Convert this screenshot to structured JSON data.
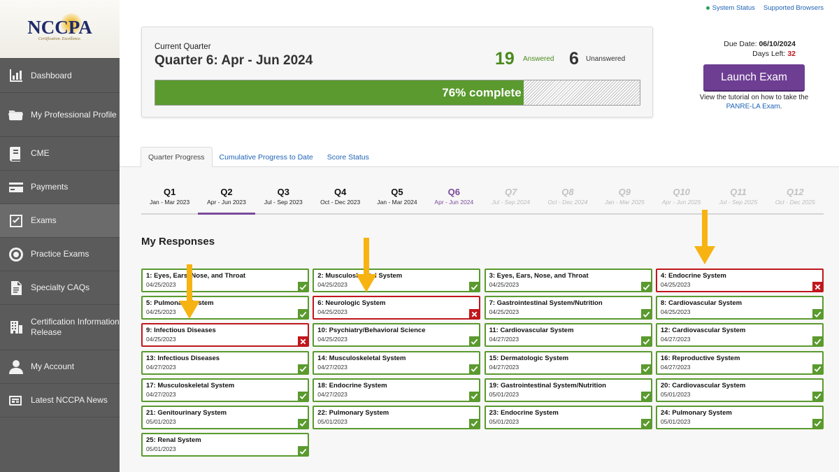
{
  "logo": {
    "text": "NCCPA",
    "tagline": "Certification. Excellence."
  },
  "sidebar": {
    "items": [
      {
        "label": "Dashboard",
        "icon": "chart-icon",
        "active": false
      },
      {
        "label": "My Professional Profile",
        "icon": "folder-icon",
        "active": false
      },
      {
        "label": "CME",
        "icon": "book-icon",
        "active": false
      },
      {
        "label": "Payments",
        "icon": "card-icon",
        "active": false
      },
      {
        "label": "Exams",
        "icon": "checkbox-icon",
        "active": true
      },
      {
        "label": "Practice Exams",
        "icon": "target-icon",
        "active": false
      },
      {
        "label": "Specialty CAQs",
        "icon": "document-icon",
        "active": false
      },
      {
        "label": "Certification Information Release",
        "icon": "building-icon",
        "active": false
      },
      {
        "label": "My Account",
        "icon": "user-icon",
        "active": false
      },
      {
        "label": "Latest NCCPA News",
        "icon": "newspaper-icon",
        "active": false
      }
    ]
  },
  "toplinks": {
    "status": "System Status",
    "browsers": "Supported Browsers",
    "status_color": "#2f9e5b"
  },
  "progress": {
    "label": "Current Quarter",
    "title": "Quarter 6: Apr - Jun 2024",
    "answered": "19",
    "answered_label": "Answered",
    "unanswered": "6",
    "unanswered_label": "Unanswered",
    "percent": 76,
    "percent_text": "76% complete"
  },
  "due": {
    "label": "Due Date:",
    "date": "06/10/2024",
    "days_label": "Days Left:",
    "days": "32"
  },
  "launch": {
    "label": "Launch Exam",
    "tutorial_prefix": "View the tutorial on how to take the ",
    "tutorial_link": "PANRE-LA Exam",
    "tutorial_suffix": "."
  },
  "tabs": [
    {
      "label": "Quarter Progress",
      "active": true
    },
    {
      "label": "Cumulative Progress to Date",
      "active": false
    },
    {
      "label": "Score Status",
      "active": false
    }
  ],
  "quarters": [
    {
      "name": "Q1",
      "dates": "Jan - Mar 2023",
      "state": "past"
    },
    {
      "name": "Q2",
      "dates": "Apr - Jun 2023",
      "state": "selected"
    },
    {
      "name": "Q3",
      "dates": "Jul - Sep 2023",
      "state": "past"
    },
    {
      "name": "Q4",
      "dates": "Oct - Dec 2023",
      "state": "past"
    },
    {
      "name": "Q5",
      "dates": "Jan - Mar 2024",
      "state": "past"
    },
    {
      "name": "Q6",
      "dates": "Apr - Jun 2024",
      "state": "current"
    },
    {
      "name": "Q7",
      "dates": "Jul - Sep 2024",
      "state": "future"
    },
    {
      "name": "Q8",
      "dates": "Oct - Dec 2024",
      "state": "future"
    },
    {
      "name": "Q9",
      "dates": "Jan - Mar 2025",
      "state": "future"
    },
    {
      "name": "Q10",
      "dates": "Apr - Jun 2025",
      "state": "future"
    },
    {
      "name": "Q11",
      "dates": "Jul - Sep 2025",
      "state": "future"
    },
    {
      "name": "Q12",
      "dates": "Oct - Dec 2025",
      "state": "future"
    }
  ],
  "responses_title": "My Responses",
  "responses": [
    {
      "title": "1: Eyes, Ears, Nose, and Throat",
      "date": "04/25/2023",
      "correct": true
    },
    {
      "title": "2: Musculoskeletal System",
      "date": "04/25/2023",
      "correct": true
    },
    {
      "title": "3: Eyes, Ears, Nose, and Throat",
      "date": "04/25/2023",
      "correct": true
    },
    {
      "title": "4: Endocrine System",
      "date": "04/25/2023",
      "correct": false
    },
    {
      "title": "5: Pulmonary System",
      "date": "04/25/2023",
      "correct": true
    },
    {
      "title": "6: Neurologic System",
      "date": "04/25/2023",
      "correct": false
    },
    {
      "title": "7: Gastrointestinal System/Nutrition",
      "date": "04/25/2023",
      "correct": true
    },
    {
      "title": "8: Cardiovascular System",
      "date": "04/25/2023",
      "correct": true
    },
    {
      "title": "9: Infectious Diseases",
      "date": "04/25/2023",
      "correct": false
    },
    {
      "title": "10: Psychiatry/Behavioral Science",
      "date": "04/25/2023",
      "correct": true
    },
    {
      "title": "11: Cardiovascular System",
      "date": "04/27/2023",
      "correct": true
    },
    {
      "title": "12: Cardiovascular System",
      "date": "04/27/2023",
      "correct": true
    },
    {
      "title": "13: Infectious Diseases",
      "date": "04/27/2023",
      "correct": true
    },
    {
      "title": "14: Musculoskeletal System",
      "date": "04/27/2023",
      "correct": true
    },
    {
      "title": "15: Dermatologic System",
      "date": "04/27/2023",
      "correct": true
    },
    {
      "title": "16: Reproductive System",
      "date": "04/27/2023",
      "correct": true
    },
    {
      "title": "17: Musculoskeletal System",
      "date": "04/27/2023",
      "correct": true
    },
    {
      "title": "18: Endocrine System",
      "date": "04/27/2023",
      "correct": true
    },
    {
      "title": "19: Gastrointestinal System/Nutrition",
      "date": "05/01/2023",
      "correct": true
    },
    {
      "title": "20: Cardiovascular System",
      "date": "05/01/2023",
      "correct": true
    },
    {
      "title": "21: Genitourinary System",
      "date": "05/01/2023",
      "correct": true
    },
    {
      "title": "22: Pulmonary System",
      "date": "05/01/2023",
      "correct": true
    },
    {
      "title": "23: Endocrine System",
      "date": "05/01/2023",
      "correct": true
    },
    {
      "title": "24: Pulmonary System",
      "date": "05/01/2023",
      "correct": true
    },
    {
      "title": "25: Renal System",
      "date": "05/01/2023",
      "correct": true
    }
  ],
  "colors": {
    "correct": "#5a9a2e",
    "incorrect": "#c0171c",
    "accent": "#6e3e93",
    "arrow": "#f6b312"
  }
}
